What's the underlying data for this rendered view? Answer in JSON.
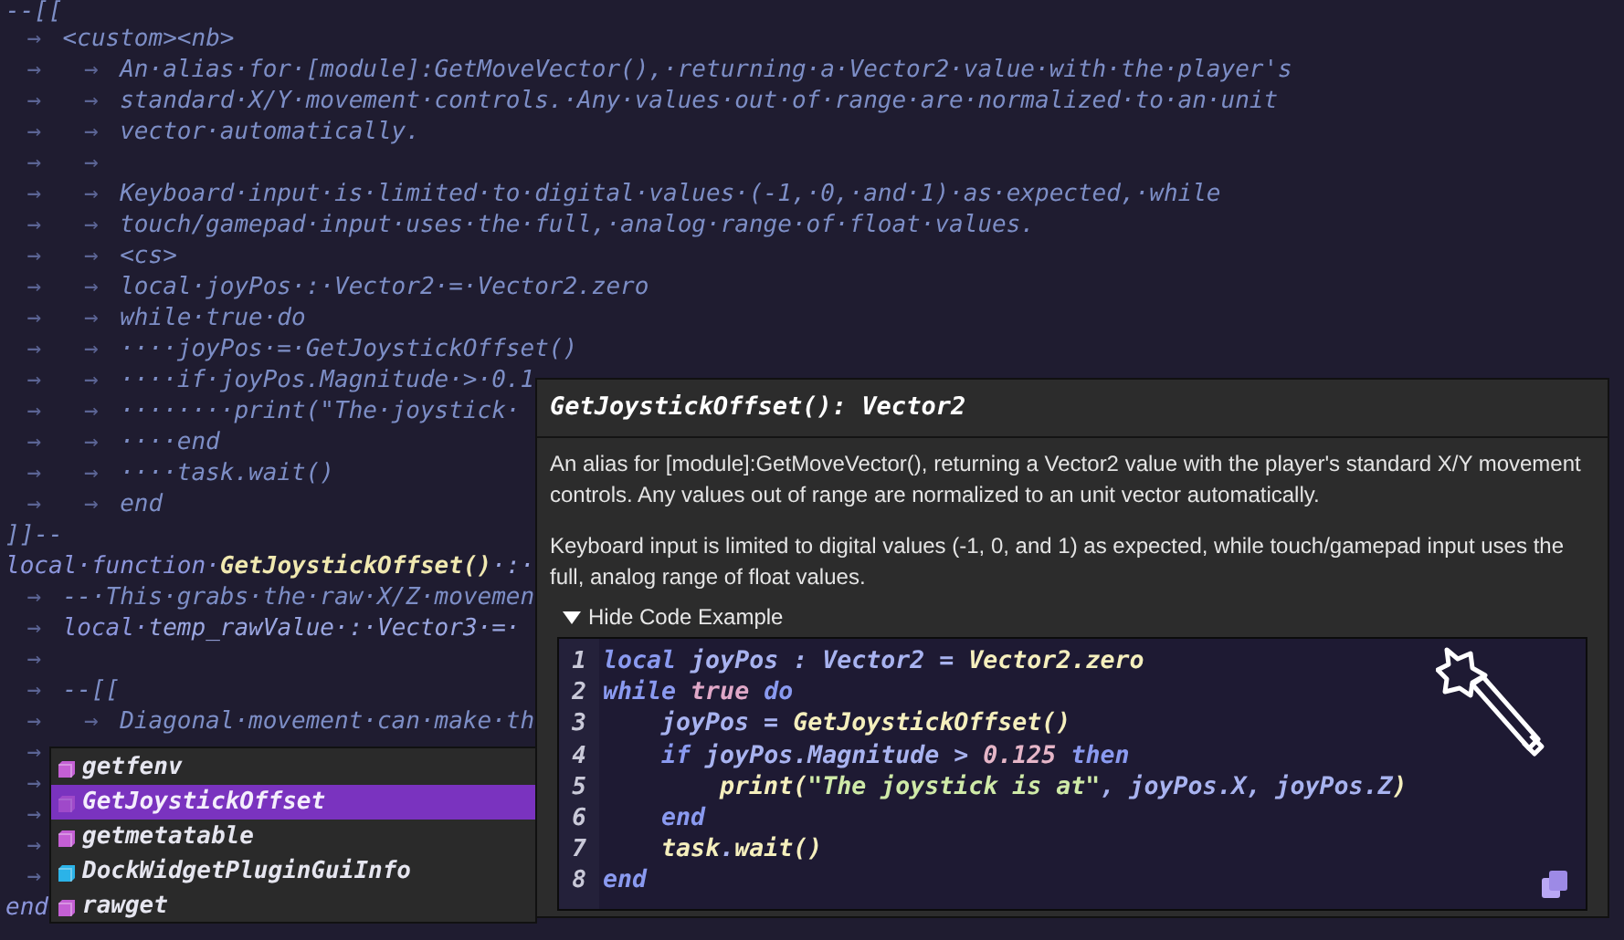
{
  "editor": {
    "lines": [
      {
        "segments": [
          {
            "kind": "comment",
            "text": "--[["
          }
        ]
      },
      {
        "segments": [
          {
            "kind": "tab",
            "text": "→"
          },
          {
            "kind": "comment",
            "text": "<custom><nb>"
          }
        ]
      },
      {
        "segments": [
          {
            "kind": "tab",
            "text": "→"
          },
          {
            "kind": "tab",
            "text": "→"
          },
          {
            "kind": "comment",
            "text": "An·alias·for·[module]:GetMoveVector(),·returning·a·Vector2·value·with·the·player's"
          }
        ]
      },
      {
        "segments": [
          {
            "kind": "tab",
            "text": "→"
          },
          {
            "kind": "tab",
            "text": "→"
          },
          {
            "kind": "comment",
            "text": "standard·X/Y·movement·controls.·Any·values·out·of·range·are·normalized·to·an·unit"
          }
        ]
      },
      {
        "segments": [
          {
            "kind": "tab",
            "text": "→"
          },
          {
            "kind": "tab",
            "text": "→"
          },
          {
            "kind": "comment",
            "text": "vector·automatically."
          }
        ]
      },
      {
        "segments": [
          {
            "kind": "tab",
            "text": "→"
          },
          {
            "kind": "tab",
            "text": "→"
          }
        ]
      },
      {
        "segments": [
          {
            "kind": "tab",
            "text": "→"
          },
          {
            "kind": "tab",
            "text": "→"
          },
          {
            "kind": "comment",
            "text": "Keyboard·input·is·limited·to·digital·values·(-1,·0,·and·1)·as·expected,·while"
          }
        ]
      },
      {
        "segments": [
          {
            "kind": "tab",
            "text": "→"
          },
          {
            "kind": "tab",
            "text": "→"
          },
          {
            "kind": "comment",
            "text": "touch/gamepad·input·uses·the·full,·analog·range·of·float·values."
          }
        ]
      },
      {
        "segments": [
          {
            "kind": "tab",
            "text": "→"
          },
          {
            "kind": "tab",
            "text": "→"
          },
          {
            "kind": "comment",
            "text": "<cs>"
          }
        ]
      },
      {
        "segments": [
          {
            "kind": "tab",
            "text": "→"
          },
          {
            "kind": "tab",
            "text": "→"
          },
          {
            "kind": "comment",
            "text": "local·joyPos·:·Vector2·=·Vector2.zero"
          }
        ]
      },
      {
        "segments": [
          {
            "kind": "tab",
            "text": "→"
          },
          {
            "kind": "tab",
            "text": "→"
          },
          {
            "kind": "comment",
            "text": "while·true·do"
          }
        ]
      },
      {
        "segments": [
          {
            "kind": "tab",
            "text": "→"
          },
          {
            "kind": "tab",
            "text": "→"
          },
          {
            "kind": "comment",
            "text": "····joyPos·=·GetJoystickOffset()"
          }
        ]
      },
      {
        "segments": [
          {
            "kind": "tab",
            "text": "→"
          },
          {
            "kind": "tab",
            "text": "→"
          },
          {
            "kind": "comment",
            "text": "····if·joyPos.Magnitude·>·0.1"
          }
        ]
      },
      {
        "segments": [
          {
            "kind": "tab",
            "text": "→"
          },
          {
            "kind": "tab",
            "text": "→"
          },
          {
            "kind": "comment",
            "text": "········print(\"The·joystick·"
          }
        ]
      },
      {
        "segments": [
          {
            "kind": "tab",
            "text": "→"
          },
          {
            "kind": "tab",
            "text": "→"
          },
          {
            "kind": "comment",
            "text": "····end"
          }
        ]
      },
      {
        "segments": [
          {
            "kind": "tab",
            "text": "→"
          },
          {
            "kind": "tab",
            "text": "→"
          },
          {
            "kind": "comment",
            "text": "····task.wait()"
          }
        ]
      },
      {
        "segments": [
          {
            "kind": "tab",
            "text": "→"
          },
          {
            "kind": "tab",
            "text": "→"
          },
          {
            "kind": "comment",
            "text": "end"
          }
        ]
      },
      {
        "segments": [
          {
            "kind": "comment",
            "text": "]]--"
          }
        ]
      },
      {
        "segments": [
          {
            "kind": "keyword",
            "text": "local·function·"
          },
          {
            "kind": "function",
            "text": "GetJoystickOffset()"
          },
          {
            "kind": "plain",
            "text": "·:·"
          }
        ]
      },
      {
        "segments": [
          {
            "kind": "tab",
            "text": "→"
          },
          {
            "kind": "comment",
            "text": "--·This·grabs·the·raw·X/Z·movemen"
          }
        ]
      },
      {
        "segments": [
          {
            "kind": "tab",
            "text": "→"
          },
          {
            "kind": "keyword",
            "text": "local·"
          },
          {
            "kind": "plain",
            "text": "temp_rawValue·:·Vector3·=·"
          }
        ]
      },
      {
        "segments": [
          {
            "kind": "tab",
            "text": "→"
          }
        ]
      },
      {
        "segments": [
          {
            "kind": "tab",
            "text": "→"
          },
          {
            "kind": "comment",
            "text": "--[["
          }
        ]
      },
      {
        "segments": [
          {
            "kind": "tab",
            "text": "→"
          },
          {
            "kind": "tab",
            "text": "→"
          },
          {
            "kind": "comment",
            "text": "Diagonal·movement·can·make·th"
          }
        ]
      },
      {
        "segments": [
          {
            "kind": "tab",
            "text": "→"
          }
        ]
      },
      {
        "segments": [
          {
            "kind": "tab",
            "text": "→"
          }
        ]
      },
      {
        "segments": [
          {
            "kind": "tab",
            "text": "→"
          }
        ]
      },
      {
        "segments": [
          {
            "kind": "tab",
            "text": "→"
          }
        ]
      },
      {
        "segments": [
          {
            "kind": "tab",
            "text": "→"
          }
        ]
      },
      {
        "segments": [
          {
            "kind": "keyword",
            "text": "end"
          }
        ]
      }
    ]
  },
  "autocomplete": {
    "items": [
      {
        "label": "getfenv",
        "kind": "function",
        "selected": false
      },
      {
        "label": "GetJoystickOffset",
        "kind": "function",
        "selected": true
      },
      {
        "label": "getmetatable",
        "kind": "function",
        "selected": false
      },
      {
        "label": "DockWidgetPluginGuiInfo",
        "kind": "class",
        "selected": false
      },
      {
        "label": "rawget",
        "kind": "function",
        "selected": false
      }
    ]
  },
  "tooltip": {
    "signature": "GetJoystickOffset(): Vector2",
    "paragraphs": [
      "An alias for [module]:GetMoveVector(), returning a Vector2 value with the player's standard X/Y movement controls. Any values out of range are normalized to an unit vector automatically.",
      "Keyboard input is limited to digital values (-1, 0, and 1) as expected, while touch/gamepad input uses the full, analog range of float values."
    ],
    "toggle": {
      "label": "Hide Code Example",
      "expanded": true
    },
    "code": [
      {
        "number": "1",
        "tokens": [
          {
            "kind": "keyword",
            "text": "local "
          },
          {
            "kind": "var",
            "text": "joyPos : Vector2 = "
          },
          {
            "kind": "function",
            "text": "Vector2.zero"
          }
        ]
      },
      {
        "number": "2",
        "tokens": [
          {
            "kind": "keyword",
            "text": "while "
          },
          {
            "kind": "bool",
            "text": "true "
          },
          {
            "kind": "keyword",
            "text": "do"
          }
        ]
      },
      {
        "number": "3",
        "tokens": [
          {
            "kind": "var",
            "text": "    joyPos = "
          },
          {
            "kind": "function",
            "text": "GetJoystickOffset()"
          }
        ]
      },
      {
        "number": "4",
        "tokens": [
          {
            "kind": "keyword",
            "text": "    if "
          },
          {
            "kind": "var",
            "text": "joyPos.Magnitude > "
          },
          {
            "kind": "number",
            "text": "0.125 "
          },
          {
            "kind": "keyword",
            "text": "then"
          }
        ]
      },
      {
        "number": "5",
        "tokens": [
          {
            "kind": "function",
            "text": "        print("
          },
          {
            "kind": "string",
            "text": "\"The joystick is at\""
          },
          {
            "kind": "var",
            "text": ", joyPos.X, joyPos.Z"
          },
          {
            "kind": "function",
            "text": ")"
          }
        ]
      },
      {
        "number": "6",
        "tokens": [
          {
            "kind": "keyword",
            "text": "    end"
          }
        ]
      },
      {
        "number": "7",
        "tokens": [
          {
            "kind": "function",
            "text": "    task"
          },
          {
            "kind": "var",
            "text": "."
          },
          {
            "kind": "function",
            "text": "wait()"
          }
        ]
      },
      {
        "number": "8",
        "tokens": [
          {
            "kind": "keyword",
            "text": "end"
          }
        ]
      }
    ]
  }
}
